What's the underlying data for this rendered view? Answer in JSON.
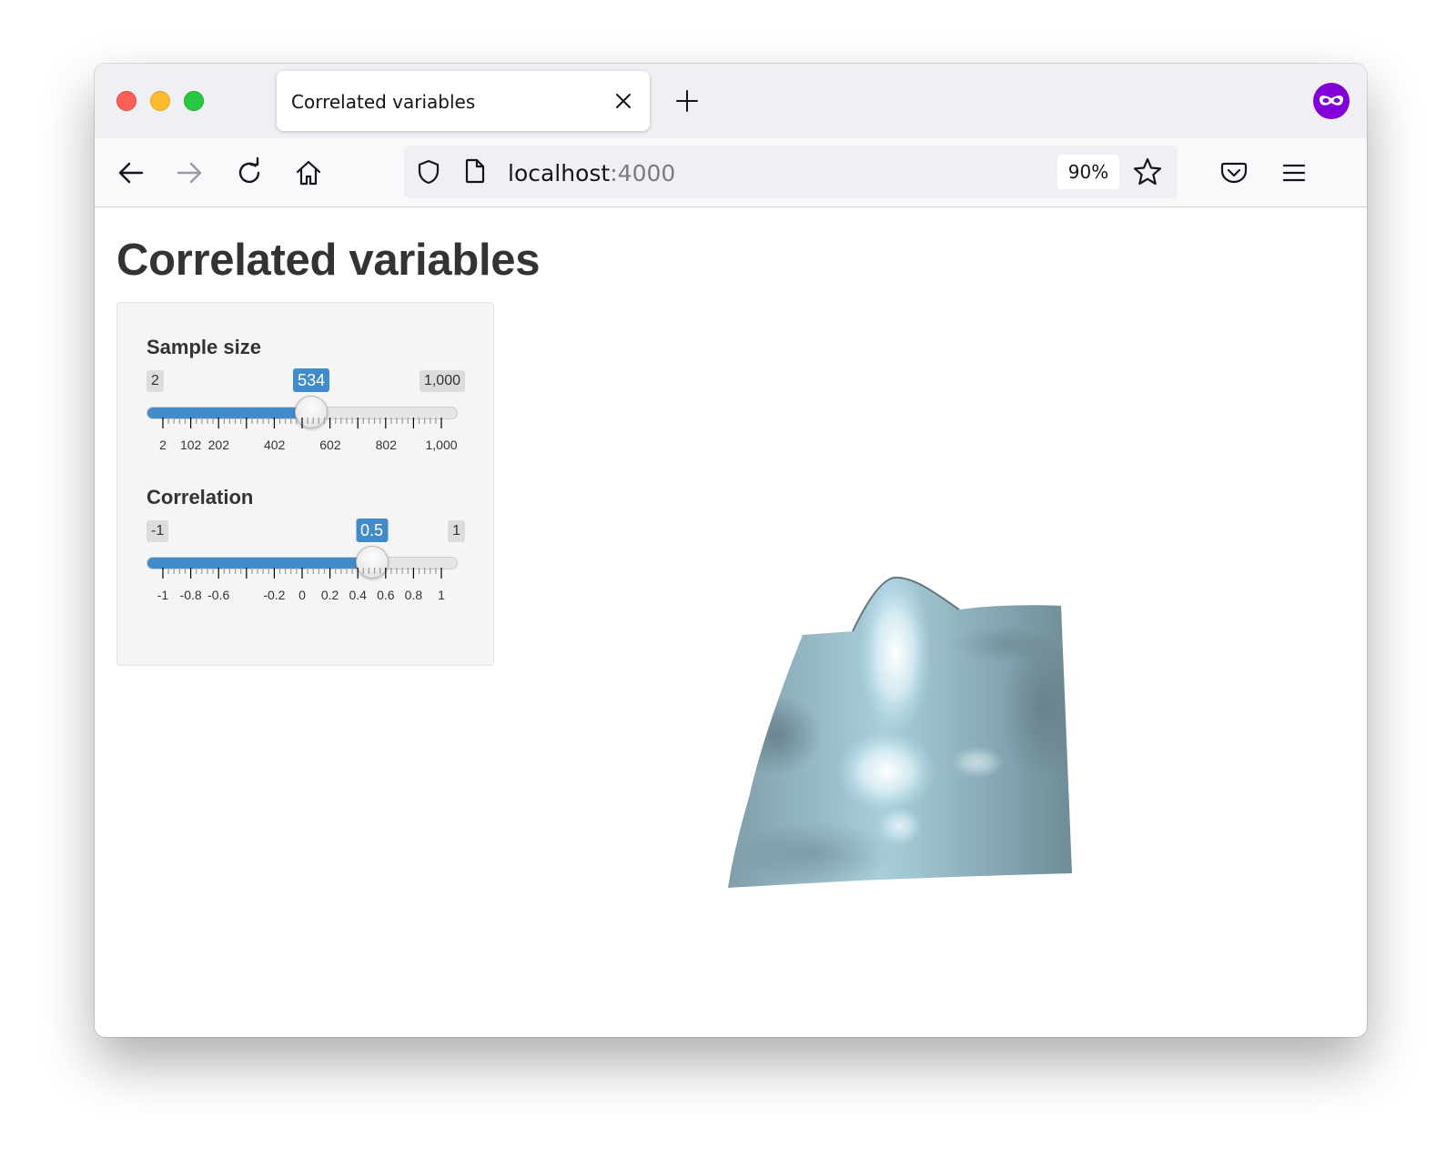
{
  "browser": {
    "tab_title": "Correlated variables",
    "url_host": "localhost",
    "url_port": ":4000",
    "zoom": "90%",
    "icons": [
      "back-arrow-icon",
      "forward-arrow-icon",
      "reload-icon",
      "home-icon",
      "shield-icon",
      "page-icon",
      "star-icon",
      "pocket-icon",
      "menu-icon",
      "close-icon",
      "plus-icon",
      "private-browsing-icon"
    ]
  },
  "page": {
    "title": "Correlated variables"
  },
  "controls": {
    "sample_size": {
      "label": "Sample size",
      "min_label": "2",
      "max_label": "1,000",
      "value_label": "534",
      "min": 2,
      "max": 1000,
      "value": 534,
      "tick_labels": [
        "2",
        "102",
        "202",
        "402",
        "602",
        "802",
        "1,000"
      ],
      "tick_values": [
        2,
        102,
        202,
        402,
        602,
        802,
        1000
      ]
    },
    "correlation": {
      "label": "Correlation",
      "min_label": "-1",
      "max_label": "1",
      "value_label": "0.5",
      "min": -1,
      "max": 1,
      "value": 0.5,
      "tick_labels": [
        "-1",
        "-0.8",
        "-0.6",
        "-0.2",
        "0",
        "0.2",
        "0.4",
        "0.6",
        "0.8",
        "1"
      ],
      "tick_values": [
        -1,
        -0.8,
        -0.6,
        -0.2,
        0,
        0.2,
        0.4,
        0.6,
        0.8,
        1
      ]
    }
  },
  "colors": {
    "accent": "#428bca",
    "surface_light": "#b9e1ee",
    "surface_dark": "#6f8c96"
  }
}
